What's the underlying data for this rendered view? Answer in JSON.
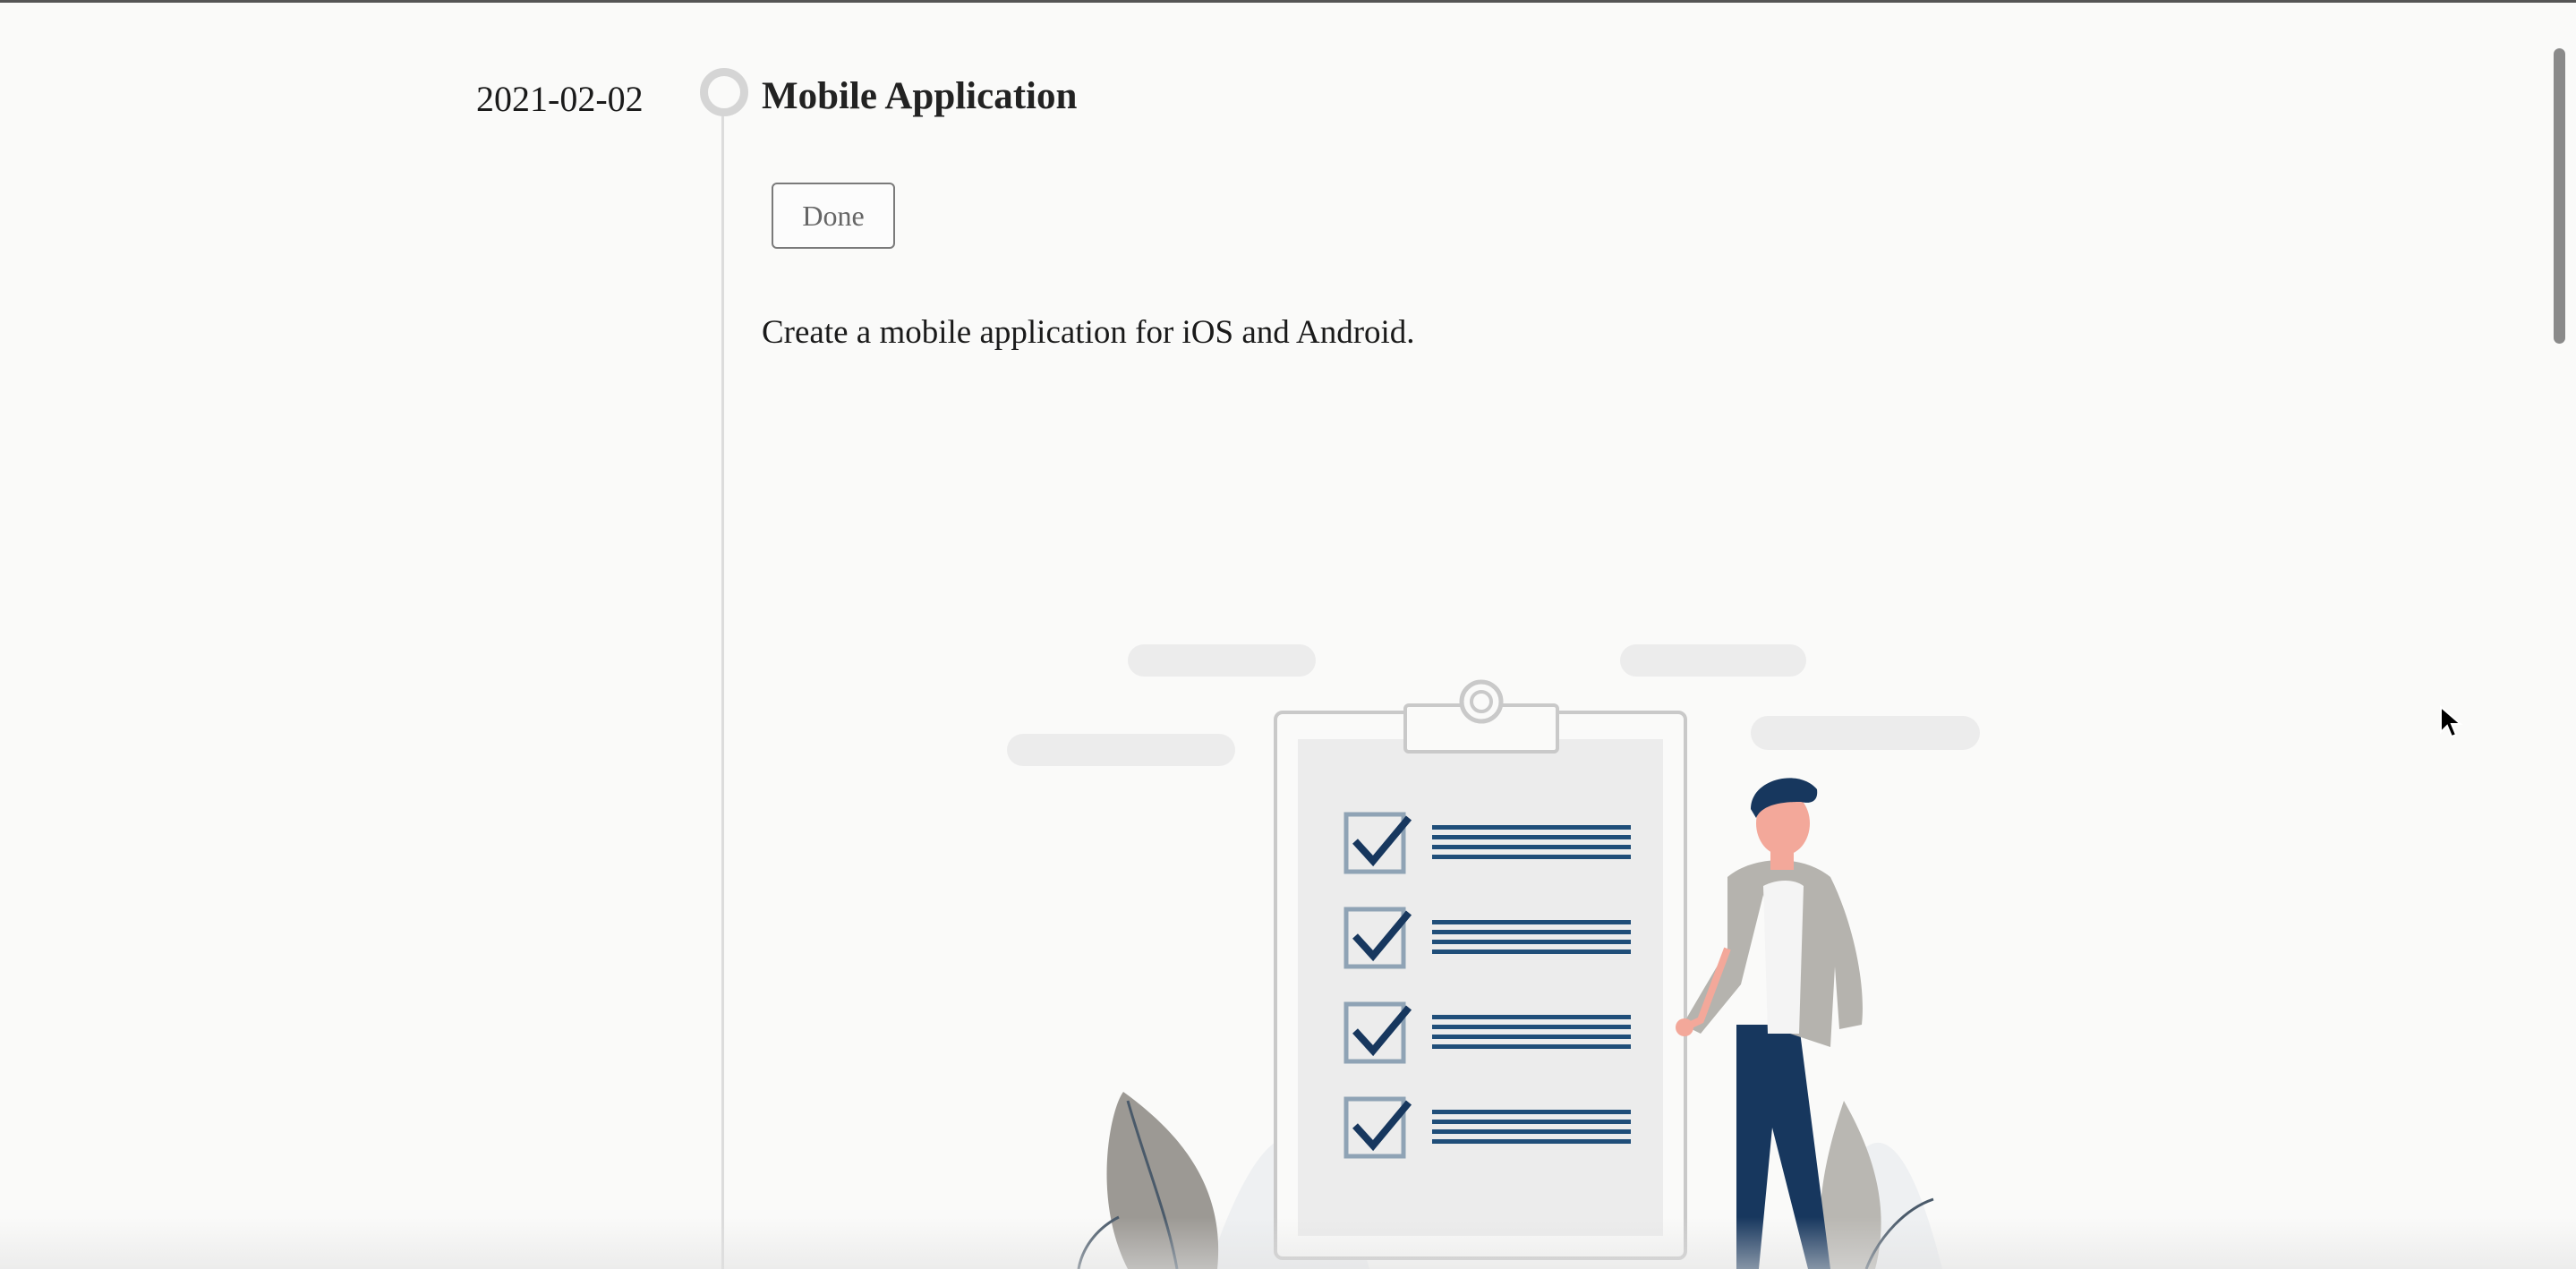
{
  "entry": {
    "date": "2021-02-02",
    "title": "Mobile Application",
    "status_label": "Done",
    "description": "Create a mobile application for iOS and Android."
  },
  "illustration": {
    "subject": "checklist-clipboard-with-person",
    "colors": {
      "navy": "#1f4e79",
      "dark_navy": "#17375e",
      "jacket_gray": "#b5b3ae",
      "plant_gray": "#9c9994",
      "skin": "#f3a89a",
      "clipboard_bg": "#ececec",
      "cloud": "#ececec"
    }
  },
  "icons": {
    "timeline_dot": "circle-ring-icon",
    "cursor": "mouse-pointer-icon"
  }
}
